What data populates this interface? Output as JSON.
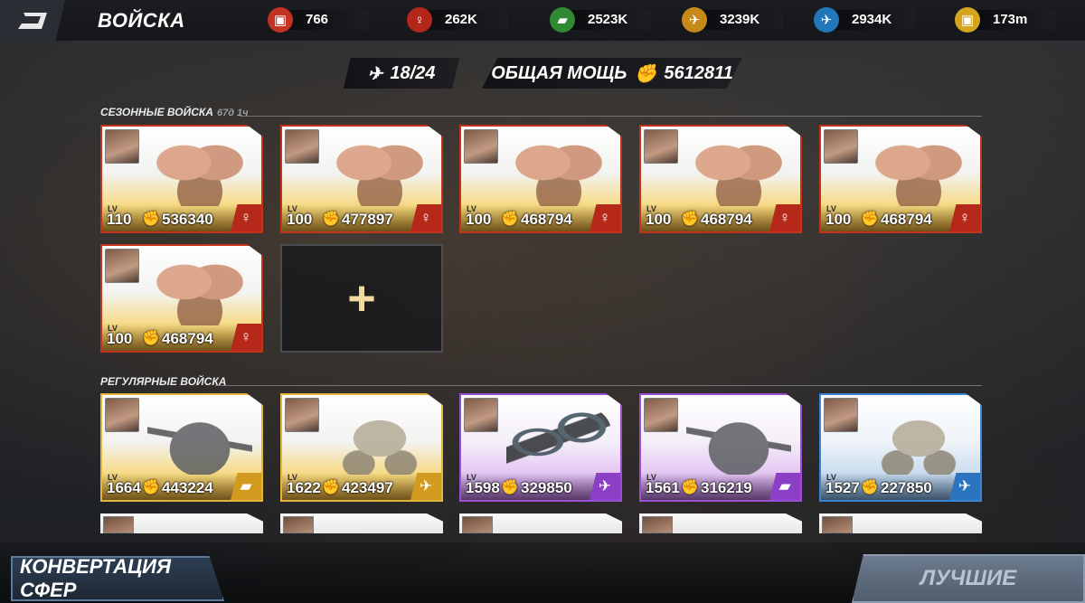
{
  "header": {
    "title": "ВОЙСКА"
  },
  "resources": [
    {
      "icon": "red-cube-icon",
      "value": "766",
      "color": "#c43224"
    },
    {
      "icon": "infantry-icon",
      "value": "262K",
      "color": "#b3261a"
    },
    {
      "icon": "tank-icon",
      "value": "2523K",
      "color": "#2f8a33"
    },
    {
      "icon": "mech-icon",
      "value": "3239K",
      "color": "#c58a1a"
    },
    {
      "icon": "aircraft-icon",
      "value": "2934K",
      "color": "#2277b8"
    },
    {
      "icon": "gold-cube-icon",
      "value": "173m",
      "color": "#d7a41f"
    }
  ],
  "stats": {
    "squad_count": "18/24",
    "power_label": "ОБЩАЯ МОЩЬ",
    "power_value": "5612811"
  },
  "seasonal": {
    "title": "СЕЗОННЫЕ ВОЙСКА",
    "timer": "67д 1ч",
    "units": [
      {
        "lv": "110",
        "power": "536340",
        "type": "red"
      },
      {
        "lv": "100",
        "power": "477897",
        "type": "red"
      },
      {
        "lv": "100",
        "power": "468794",
        "type": "red"
      },
      {
        "lv": "100",
        "power": "468794",
        "type": "red"
      },
      {
        "lv": "100",
        "power": "468794",
        "type": "red"
      },
      {
        "lv": "100",
        "power": "468794",
        "type": "red"
      }
    ],
    "add_symbol": "+"
  },
  "regular": {
    "title": "РЕГУЛЯРНЫЕ ВОЙСКА",
    "units": [
      {
        "lv": "1664",
        "power": "443224",
        "type": "gold"
      },
      {
        "lv": "1622",
        "power": "423497",
        "type": "gold"
      },
      {
        "lv": "1598",
        "power": "329850",
        "type": "purple"
      },
      {
        "lv": "1561",
        "power": "316219",
        "type": "purple"
      },
      {
        "lv": "1527",
        "power": "227850",
        "type": "blue"
      }
    ]
  },
  "card_labels": {
    "lv": "LV"
  },
  "buttons": {
    "convert": "КОНВЕРТАЦИЯ СФЕР",
    "best": "ЛУЧШИЕ"
  }
}
